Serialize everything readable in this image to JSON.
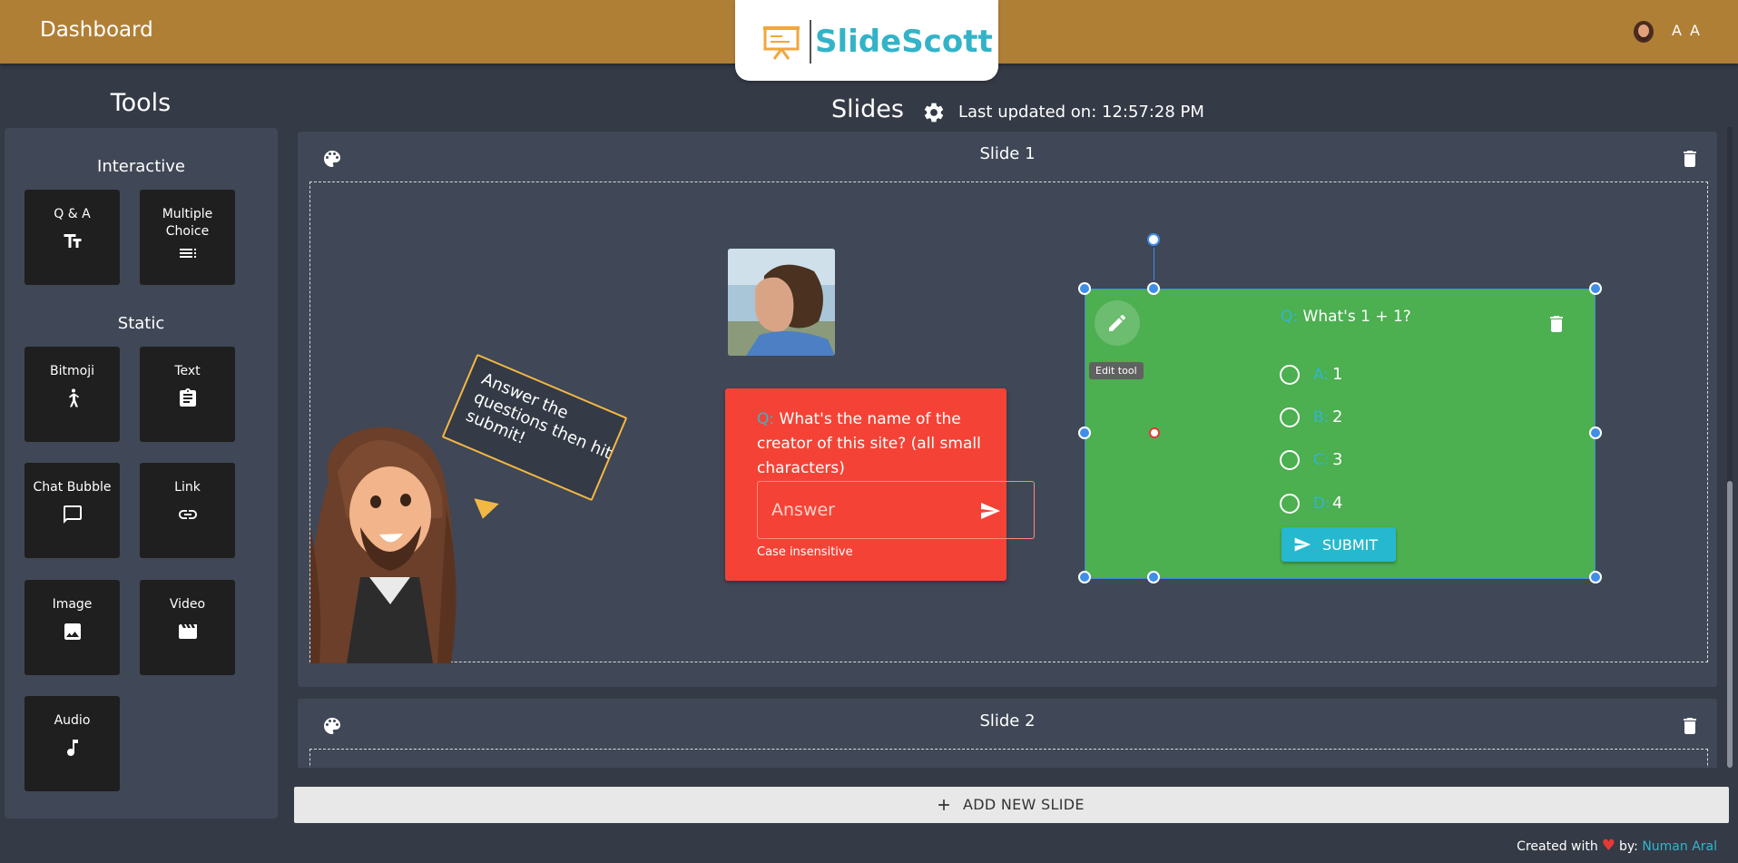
{
  "header": {
    "dashboard_label": "Dashboard",
    "logo_text": "SlideScott",
    "user_initials": "A A",
    "colors": {
      "bar": "#b07f36",
      "logo_text": "#33b3c8"
    }
  },
  "tools": {
    "title": "Tools",
    "interactive_title": "Interactive",
    "static_title": "Static",
    "items": {
      "qa": {
        "label": "Q & A",
        "icon": "text-fields-icon"
      },
      "multiple_choice": {
        "label": "Multiple Choice",
        "icon": "list-icon"
      },
      "bitmoji": {
        "label": "Bitmoji",
        "icon": "person-icon"
      },
      "text": {
        "label": "Text",
        "icon": "clipboard-icon"
      },
      "chat_bubble": {
        "label": "Chat Bubble",
        "icon": "chat-icon"
      },
      "link": {
        "label": "Link",
        "icon": "link-icon"
      },
      "image": {
        "label": "Image",
        "icon": "image-icon"
      },
      "video": {
        "label": "Video",
        "icon": "movie-icon"
      },
      "audio": {
        "label": "Audio",
        "icon": "music-note-icon"
      }
    }
  },
  "main": {
    "heading": "Slides",
    "last_updated": "Last updated on: 12:57:28 PM"
  },
  "slides": [
    {
      "title": "Slide 1",
      "chat_bubble_text": "Answer the questions then hit submit!",
      "qa_card": {
        "prefix": "Q:",
        "question": "What's the name of the creator of this site? (all small characters)",
        "placeholder": "Answer",
        "hint": "Case insensitive",
        "color": "#f44336"
      },
      "mc_card": {
        "prefix": "Q:",
        "question": "What's 1 + 1?",
        "tooltip": "Edit tool",
        "options": [
          {
            "letter": "A:",
            "value": "1"
          },
          {
            "letter": "B:",
            "value": "2"
          },
          {
            "letter": "C:",
            "value": "3"
          },
          {
            "letter": "D:",
            "value": "4"
          }
        ],
        "submit_label": "SUBMIT",
        "color": "#4caf50"
      }
    },
    {
      "title": "Slide 2"
    }
  ],
  "add_slide_label": "ADD NEW SLIDE",
  "footer": {
    "created_with": "Created with",
    "by": "by:",
    "author": "Numan Aral"
  }
}
